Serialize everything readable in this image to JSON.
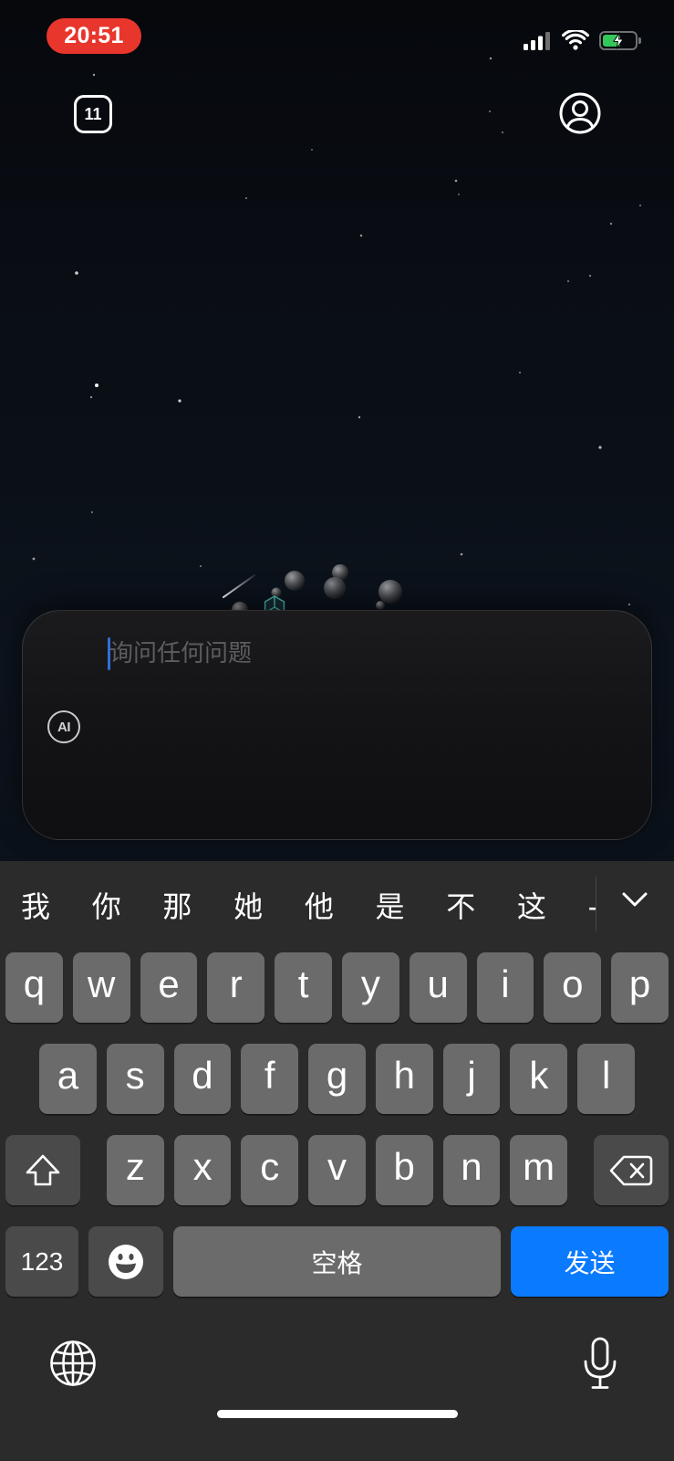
{
  "status_bar": {
    "time": "20:51",
    "battery_level": 0.55,
    "battery_charging": true,
    "icons": [
      "cellular-signal-icon",
      "wifi-icon",
      "battery-charging-icon"
    ]
  },
  "top_bar": {
    "tab_count": "11",
    "left_icon": "tabs-icon",
    "right_icon": "profile-icon"
  },
  "input": {
    "value": "",
    "placeholder": "询问任何问题",
    "ai_badge": "AI"
  },
  "keyboard": {
    "candidates": [
      "我",
      "你",
      "那",
      "她",
      "他",
      "是",
      "不",
      "这",
      "-"
    ],
    "collapse_icon": "chevron-down-icon",
    "rows": [
      [
        "q",
        "w",
        "e",
        "r",
        "t",
        "y",
        "u",
        "i",
        "o",
        "p"
      ],
      [
        "a",
        "s",
        "d",
        "f",
        "g",
        "h",
        "j",
        "k",
        "l"
      ],
      [
        "z",
        "x",
        "c",
        "v",
        "b",
        "n",
        "m"
      ]
    ],
    "shift_icon": "shift-icon",
    "delete_icon": "delete-icon",
    "numbers_label": "123",
    "emoji_icon": "emoji-icon",
    "space_label": "空格",
    "send_label": "发送",
    "globe_icon": "globe-icon",
    "dictation_icon": "microphone-icon"
  },
  "colors": {
    "time_pill": "#e8362d",
    "battery_charge": "#34c759",
    "keyboard_background": "#2b2b2b",
    "key": "#6b6b6b",
    "key_special": "#4a4a4a",
    "send_key": "#0a7aff",
    "cursor": "#2f6fd8"
  }
}
